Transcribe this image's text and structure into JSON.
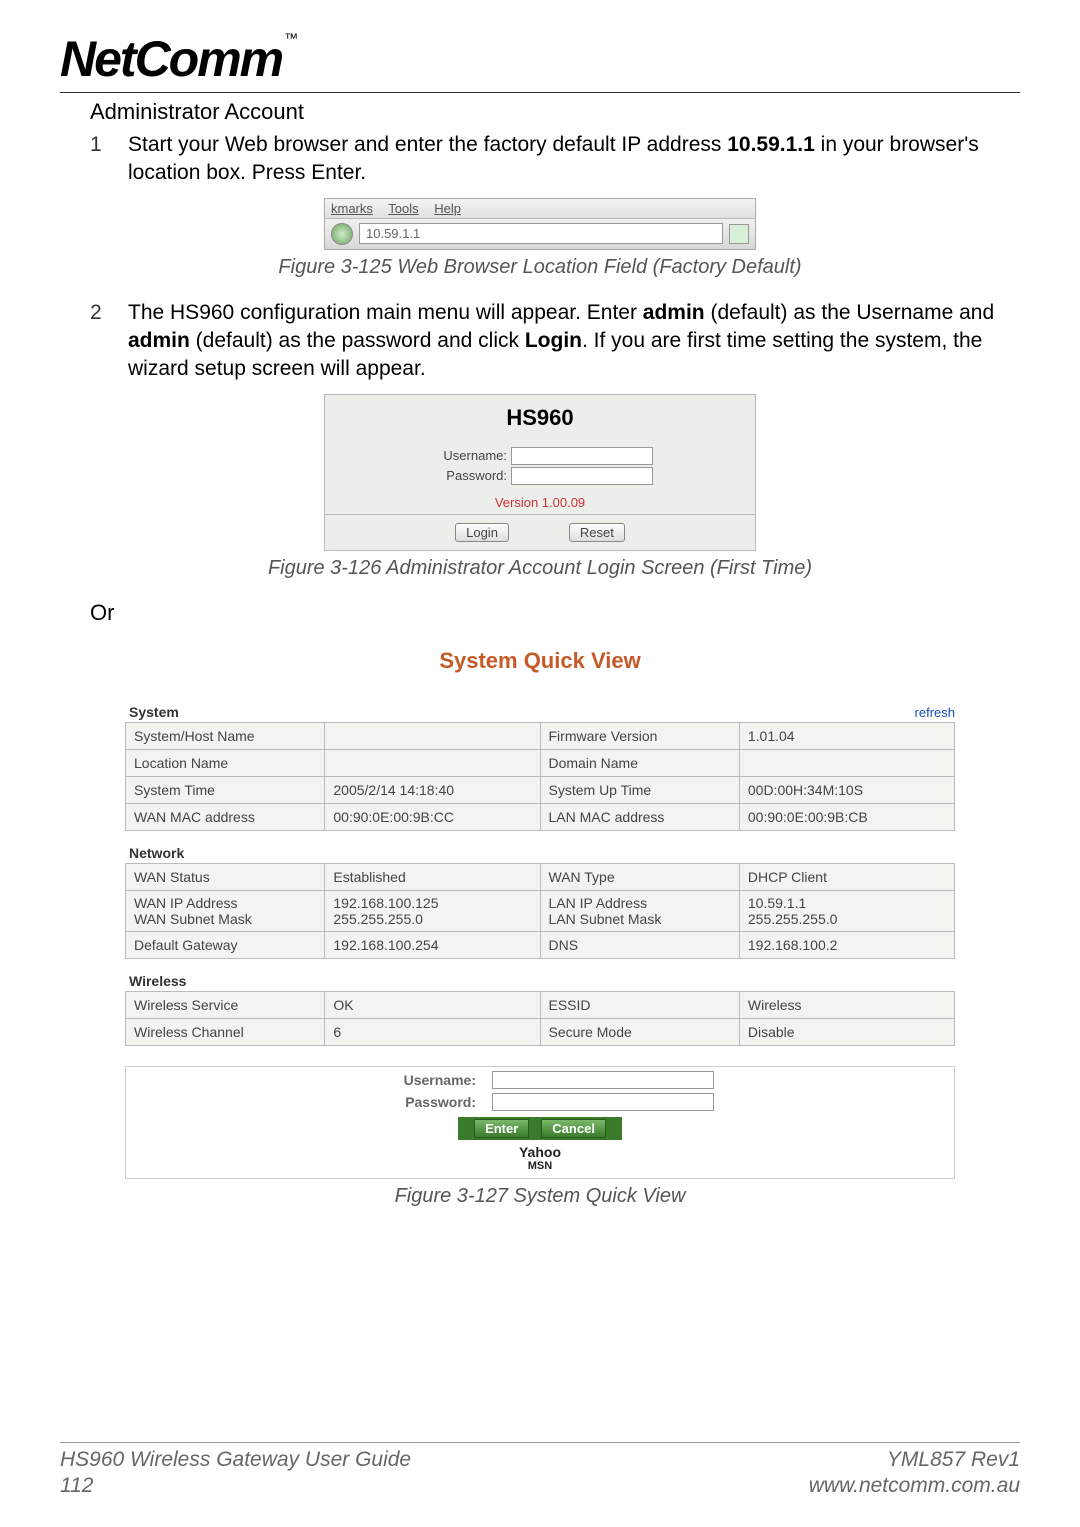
{
  "logo": {
    "text": "NetComm",
    "tm": "™"
  },
  "section_title": "Administrator Account",
  "steps": [
    {
      "num": "1",
      "prefix": "Start your Web browser and enter the factory default IP address ",
      "ip": "10.59.1.1",
      "mid": " in your browser's location box. Press Enter.",
      "suffix": ""
    },
    {
      "num": "2",
      "prefix": "The HS960 configuration main menu will appear. Enter ",
      "b1": "admin",
      "mid1": " (default) as the Username and ",
      "b2": "admin",
      "mid2": " (default) as the password and click ",
      "b3": "Login",
      "suffix": ". If you are first time setting the system, the wizard setup screen will appear."
    }
  ],
  "or_text": "Or",
  "fig125": "Figure 3-125 Web Browser Location Field (Factory Default)",
  "fig126": "Figure 3-126 Administrator Account Login Screen (First Time)",
  "fig127": "Figure 3-127 System Quick View",
  "browser": {
    "menu": [
      "kmarks",
      "Tools",
      "Help"
    ],
    "address": "10.59.1.1"
  },
  "login": {
    "title": "HS960",
    "username_label": "Username:",
    "password_label": "Password:",
    "version": "Version 1.00.09",
    "login_btn": "Login",
    "reset_btn": "Reset"
  },
  "sqv": {
    "title": "System Quick View",
    "refresh": "refresh",
    "groups": {
      "system": {
        "label": "System",
        "rows": [
          [
            "System/Host Name",
            "",
            "Firmware Version",
            "1.01.04"
          ],
          [
            "Location Name",
            "",
            "Domain Name",
            ""
          ],
          [
            "System Time",
            "2005/2/14 14:18:40",
            "System Up Time",
            "00D:00H:34M:10S"
          ],
          [
            "WAN MAC address",
            "00:90:0E:00:9B:CC",
            "LAN MAC address",
            "00:90:0E:00:9B:CB"
          ]
        ]
      },
      "network": {
        "label": "Network",
        "rows": [
          [
            "WAN Status",
            "Established",
            "WAN Type",
            "DHCP Client"
          ],
          [
            "WAN IP Address\nWAN Subnet Mask",
            "192.168.100.125\n255.255.255.0",
            "LAN IP Address\nLAN Subnet Mask",
            "10.59.1.1\n255.255.255.0"
          ],
          [
            "Default Gateway",
            "192.168.100.254",
            "DNS",
            "192.168.100.2"
          ]
        ]
      },
      "wireless": {
        "label": "Wireless",
        "rows": [
          [
            "Wireless Service",
            "OK",
            "ESSID",
            "Wireless"
          ],
          [
            "Wireless Channel",
            "6",
            "Secure Mode",
            "Disable"
          ]
        ]
      }
    },
    "auth": {
      "username_label": "Username:",
      "password_label": "Password:",
      "enter_btn": "Enter",
      "cancel_btn": "Cancel",
      "yahoo": "Yahoo",
      "msn": "MSN"
    }
  },
  "footer": {
    "left_line1": "HS960 Wireless Gateway User Guide",
    "left_line2": "112",
    "right_line1": "YML857 Rev1",
    "right_line2": "www.netcomm.com.au"
  }
}
